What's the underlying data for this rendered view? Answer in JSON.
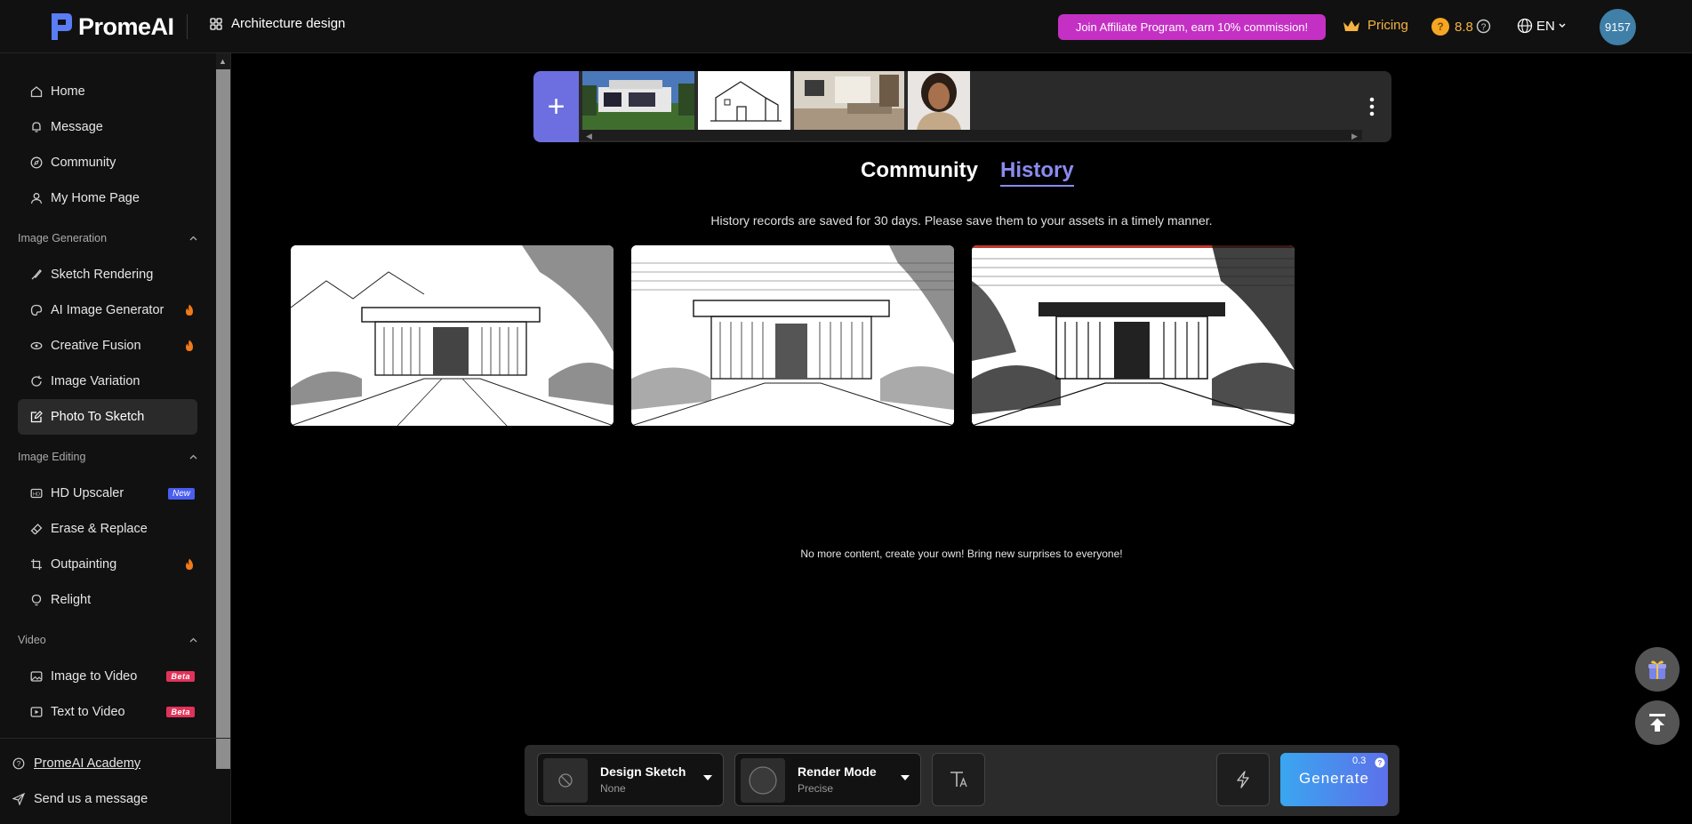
{
  "header": {
    "logo_text": "PromeAI",
    "breadcrumb": "Architecture design",
    "affiliate_label": "Join Affiliate Program, earn 10% commission!",
    "pricing_label": "Pricing",
    "credits": "8.8",
    "language": "EN",
    "avatar_text": "9157"
  },
  "sidebar": {
    "main": [
      {
        "label": "Home"
      },
      {
        "label": "Message"
      },
      {
        "label": "Community"
      },
      {
        "label": "My Home Page"
      }
    ],
    "sections": [
      {
        "title": "Image Generation",
        "items": [
          {
            "label": "Sketch Rendering"
          },
          {
            "label": "AI Image Generator",
            "badge": "hot"
          },
          {
            "label": "Creative Fusion",
            "badge": "hot"
          },
          {
            "label": "Image Variation"
          },
          {
            "label": "Photo To Sketch",
            "active": true
          }
        ]
      },
      {
        "title": "Image Editing",
        "items": [
          {
            "label": "HD Upscaler",
            "badge": "New"
          },
          {
            "label": "Erase & Replace"
          },
          {
            "label": "Outpainting",
            "badge": "hot"
          },
          {
            "label": "Relight"
          }
        ]
      },
      {
        "title": "Video",
        "items": [
          {
            "label": "Image to Video",
            "badge": "Beta"
          },
          {
            "label": "Text to Video",
            "badge": "Beta"
          }
        ]
      }
    ],
    "bottom": [
      {
        "label": "PromeAI Academy"
      },
      {
        "label": "Send us a message"
      }
    ]
  },
  "tabs": {
    "community": "Community",
    "history": "History"
  },
  "history_notice": "History records are saved for 30 days. Please save them to your assets in a timely manner.",
  "no_more_text": "No more content, create your own! Bring new surprises to everyone!",
  "generate_bar": {
    "style_title": "Design Sketch",
    "style_value": "None",
    "mode_title": "Render Mode",
    "mode_value": "Precise",
    "generate_label": "Generate",
    "cost": "0.3"
  },
  "colors": {
    "accent": "#6d6fe0",
    "history_tab": "#8b8bf0",
    "affiliate": "#c430c4",
    "gold": "#f5b342"
  }
}
